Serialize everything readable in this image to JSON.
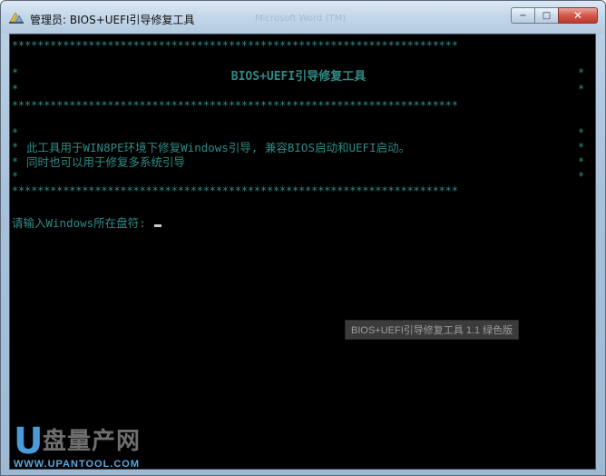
{
  "window": {
    "title": "管理员: BIOS+UEFI引导修复工具",
    "ghost_title": "Microsoft Word (TM)",
    "controls": {
      "minimize": "−",
      "maximize": "□",
      "close": "✕"
    }
  },
  "console": {
    "star_line": "**********************************************************************",
    "edge_char": "*",
    "header_title": "BIOS+UEFI引导修复工具",
    "desc_line_1": "此工具用于WIN8PE环境下修复Windows引导, 兼容BIOS启动和UEFI启动。",
    "desc_line_2": "同时也可以用于修复多系统引导",
    "prompt": "请输入Windows所在盘符: "
  },
  "version_label": "BIOS+UEFI引导修复工具 1.1 绿色版",
  "watermark": {
    "letter": "U",
    "name": "盘量产网",
    "url": "WWW.UPANTOOL.COM"
  },
  "colors": {
    "console_text": "#2e8b85",
    "console_bg": "#000000",
    "close_button": "#c0392b"
  },
  "icons": {
    "title_icon": "admin-console-icon"
  }
}
